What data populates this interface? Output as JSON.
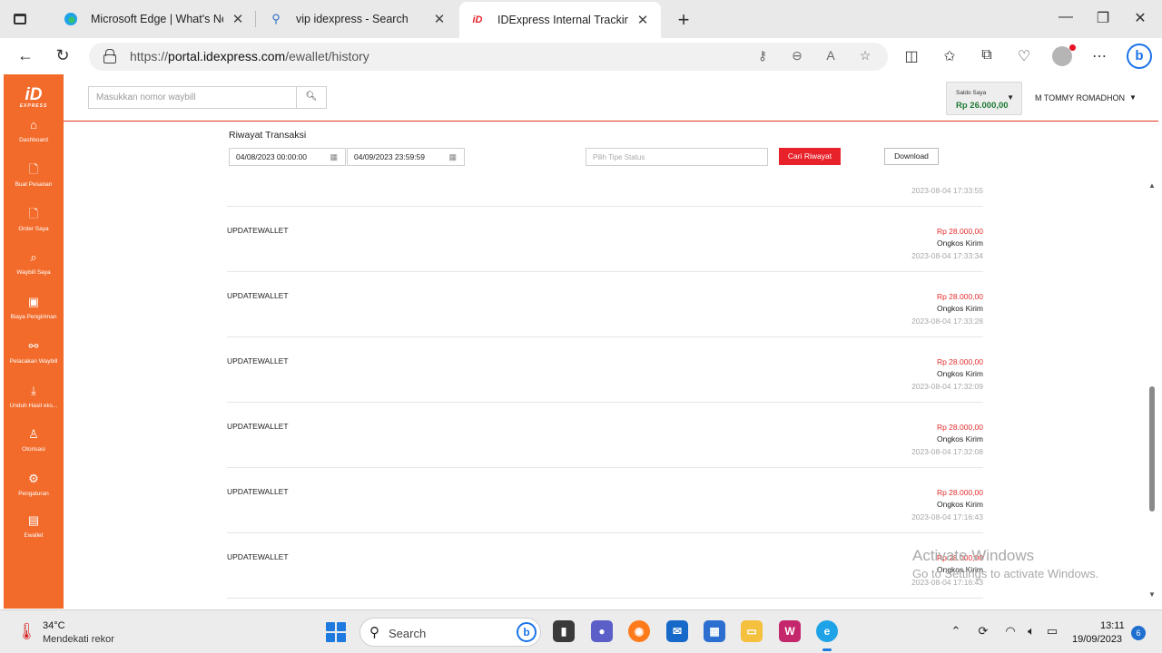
{
  "browser": {
    "tabs": [
      {
        "label": "Microsoft Edge | What's New",
        "icon": "edge-icon"
      },
      {
        "label": "vip idexpress - Search",
        "icon": "search-icon"
      },
      {
        "label": "IDExpress Internal Tracking",
        "icon": "idexpress-icon"
      }
    ],
    "url_prefix": "https://",
    "url_host": "portal.idexpress.com",
    "url_path": "/ewallet/history"
  },
  "sidebar": {
    "logo": "iD",
    "logo_sub": "EXPRESS",
    "items": [
      {
        "label": "Dashboard",
        "icon": "home-icon"
      },
      {
        "label": "Buat Pesanan",
        "icon": "document-icon"
      },
      {
        "label": "Order Saya",
        "icon": "document-icon"
      },
      {
        "label": "Waybill Saya",
        "icon": "search-doc-icon"
      },
      {
        "label": "Biaya Pengiriman",
        "icon": "calculator-icon"
      },
      {
        "label": "Pelacakan Waybill",
        "icon": "route-icon"
      },
      {
        "label": "Unduh Hasil eks...",
        "icon": "download-icon"
      },
      {
        "label": "Otorisasi",
        "icon": "user-icon"
      },
      {
        "label": "Pengaturan",
        "icon": "gear-icon"
      },
      {
        "label": "Ewallet",
        "icon": "wallet-icon"
      }
    ]
  },
  "header": {
    "search_placeholder": "Masukkan nomor waybill",
    "saldo_label": "Saldo Saya",
    "saldo_value": "Rp 26.000,00",
    "user_name": "M TOMMY ROMADHON"
  },
  "filter": {
    "title": "Riwayat Transaksi",
    "start_date": "04/08/2023 00:00:00",
    "end_date": "04/09/2023 23:59:59",
    "status_placeholder": "Pilih Tipe Status",
    "search_button": "Cari Riwayat",
    "download_button": "Download"
  },
  "transactions": [
    {
      "type": "",
      "amount": "",
      "desc": "",
      "time": "2023-08-04 17:33:55"
    },
    {
      "type": "UPDATEWALLET",
      "amount": "Rp 28.000,00",
      "desc": "Ongkos Kirim",
      "time": "2023-08-04 17:33:34"
    },
    {
      "type": "UPDATEWALLET",
      "amount": "Rp 28.000,00",
      "desc": "Ongkos Kirim",
      "time": "2023-08-04 17:33:28"
    },
    {
      "type": "UPDATEWALLET",
      "amount": "Rp 28.000,00",
      "desc": "Ongkos Kirim",
      "time": "2023-08-04 17:32:09"
    },
    {
      "type": "UPDATEWALLET",
      "amount": "Rp 28.000,00",
      "desc": "Ongkos Kirim",
      "time": "2023-08-04 17:32:08"
    },
    {
      "type": "UPDATEWALLET",
      "amount": "Rp 28.000,00",
      "desc": "Ongkos Kirim",
      "time": "2023-08-04 17:16:43"
    },
    {
      "type": "UPDATEWALLET",
      "amount": "Rp 28.000,00",
      "desc": "Ongkos Kirim",
      "time": "2023-08-04 17:16:43"
    }
  ],
  "watermark": {
    "line1": "Activate Windows",
    "line2": "Go to Settings to activate Windows."
  },
  "taskbar": {
    "temperature": "34°C",
    "weather_desc": "Mendekati rekor",
    "search_label": "Search",
    "time": "13:11",
    "date": "19/09/2023",
    "notification_count": "6"
  },
  "colors": {
    "brand_orange": "#f26b2a",
    "accent_red": "#e8222b",
    "balance_green": "#1e7a34"
  }
}
